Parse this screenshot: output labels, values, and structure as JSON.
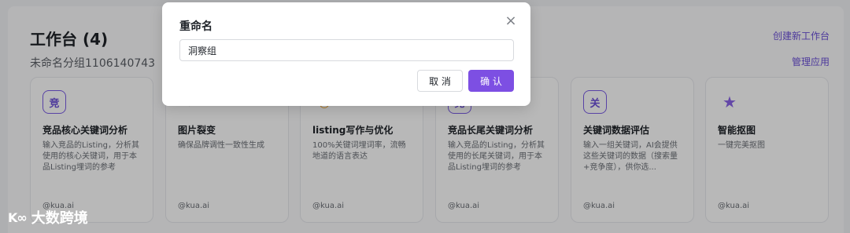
{
  "workspace": {
    "title": "工作台 (4)",
    "subtitle": "未命名分组1106140743",
    "create_link": "创建新工作台",
    "manage_link": "管理应用"
  },
  "cards": [
    {
      "icon_char": "竞",
      "icon": "compete-icon",
      "name": "竞品核心关键词分析",
      "desc": "输入竞品的Listing，分析其使用的核心关键词，用于本品Listing埋词的参考",
      "foot": "@kua.ai"
    },
    {
      "icon_char": "✦",
      "icon": "split-icon",
      "name": "图片裂变",
      "desc": "确保品牌调性一致性生成",
      "foot": "@kua.ai"
    },
    {
      "icon_char": "◡",
      "icon": "listing-icon",
      "name": "listing写作与优化",
      "desc": "100%关键词埋词率，流畅地道的语言表达",
      "foot": "@kua.ai"
    },
    {
      "icon_char": "竞",
      "icon": "compete-icon",
      "name": "竞品长尾关键词分析",
      "desc": "输入竞品的Listing，分析其使用的长尾关键词，用于本品Listing埋词的参考",
      "foot": "@kua.ai"
    },
    {
      "icon_char": "关",
      "icon": "keyword-icon",
      "name": "关键词数据评估",
      "desc": "输入一组关键词，AI会提供这些关键词的数据（搜索量+竞争度），供你选...",
      "foot": "@kua.ai"
    },
    {
      "icon_char": "★",
      "icon": "star-icon",
      "name": "智能抠图",
      "desc": "一键完美抠图",
      "foot": "@kua.ai"
    }
  ],
  "dialog": {
    "title": "重命名",
    "input_value": "洞察组",
    "cancel_label": "取 消",
    "ok_label": "确 认"
  },
  "brand": {
    "mark": "K∞",
    "name": "大数跨境"
  },
  "colors": {
    "accent": "#7d4fe3",
    "link": "#6b4fd8"
  }
}
